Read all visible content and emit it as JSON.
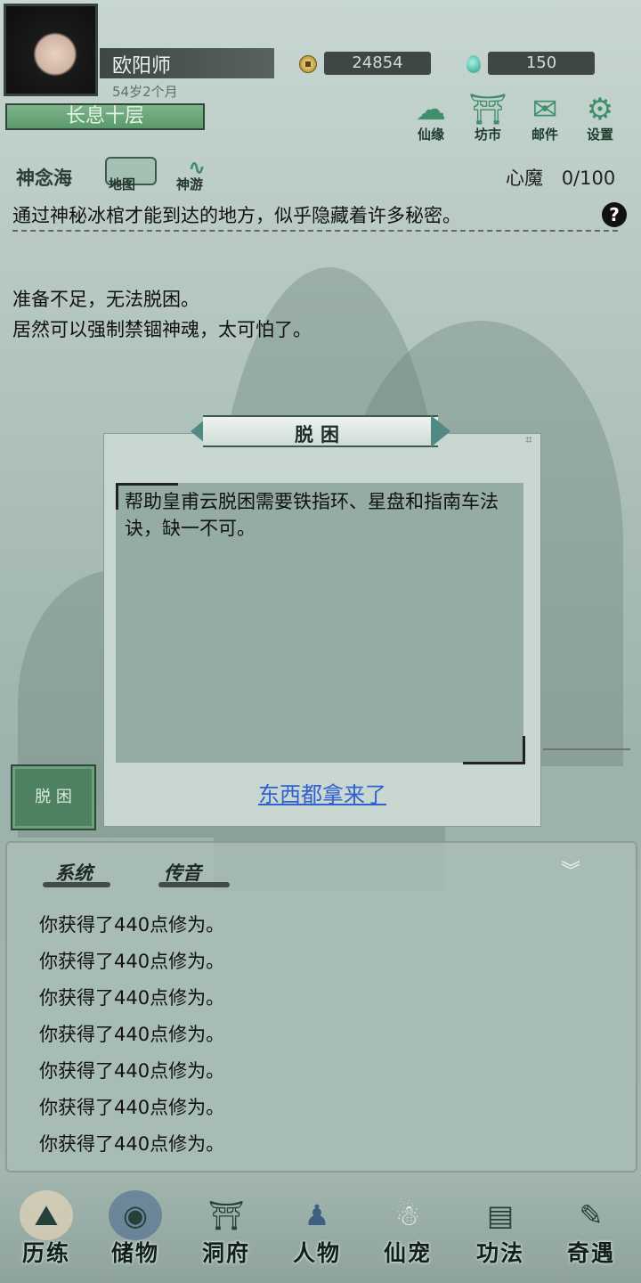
{
  "player": {
    "name": "欧阳师",
    "age": "54岁2个月",
    "realm": "长息十层",
    "coins": "24854",
    "gems": "150"
  },
  "top_menu": [
    {
      "label": "仙缘",
      "icon": "cloud-icon"
    },
    {
      "label": "坊市",
      "icon": "market-icon"
    },
    {
      "label": "邮件",
      "icon": "mail-icon"
    },
    {
      "label": "设置",
      "icon": "gear-icon"
    }
  ],
  "subheader": {
    "title": "神念海",
    "tabs": [
      {
        "label": "地图",
        "icon": "map-icon"
      },
      {
        "label": "神游",
        "icon": "wave-icon"
      }
    ],
    "xinmo_label": "心魔",
    "xinmo_value": "0/100"
  },
  "story": {
    "line1": "通过神秘冰棺才能到达的地方，似乎隐藏着许多秘密。",
    "line2": "准备不足，无法脱困。",
    "line3": "居然可以强制禁锢神魂，太可怕了。"
  },
  "action_button": "脱 困",
  "dialog": {
    "title": "脱困",
    "content": "帮助皇甫云脱困需要铁指环、星盘和指南车法诀，缺一不可。",
    "link": "东西都拿来了"
  },
  "log": {
    "tabs": [
      "系统",
      "传音"
    ],
    "lines": [
      "你获得了440点修为。",
      "你获得了440点修为。",
      "你获得了440点修为。",
      "你获得了440点修为。",
      "你获得了440点修为。",
      "你获得了440点修为。",
      "你获得了440点修为。"
    ]
  },
  "bottom_nav": [
    {
      "label": "历练",
      "icon": "mountain-icon"
    },
    {
      "label": "储物",
      "icon": "bag-icon"
    },
    {
      "label": "洞府",
      "icon": "pagoda-icon"
    },
    {
      "label": "人物",
      "icon": "person-icon"
    },
    {
      "label": "仙宠",
      "icon": "pet-icon"
    },
    {
      "label": "功法",
      "icon": "book-icon"
    },
    {
      "label": "奇遇",
      "icon": "brush-icon"
    }
  ]
}
